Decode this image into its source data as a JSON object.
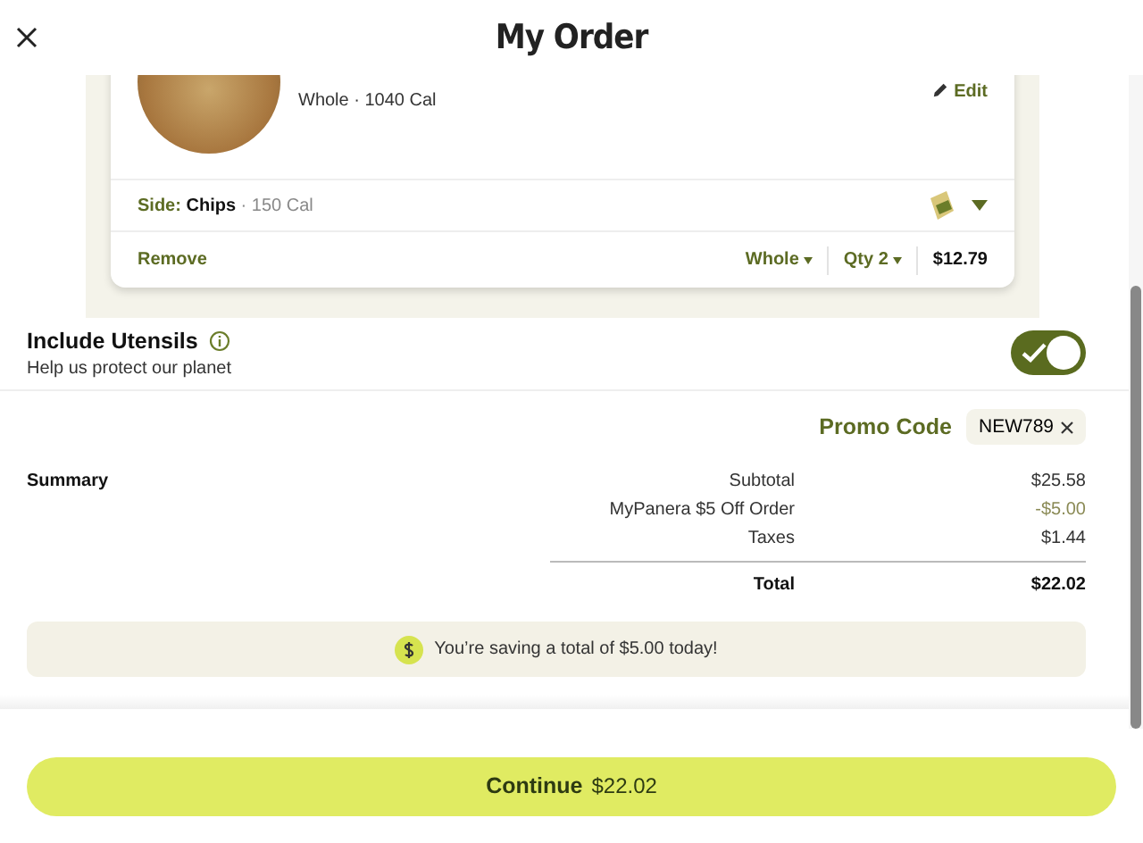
{
  "header": {
    "title": "My Order"
  },
  "item": {
    "details": "Whole · 1040 Cal",
    "edit": "Edit",
    "side_label": "Side:",
    "side_name": "Chips",
    "side_cal": "· 150 Cal",
    "remove": "Remove",
    "size": "Whole",
    "qty": "Qty 2",
    "price": "$12.79"
  },
  "utensils": {
    "title": "Include Utensils",
    "subtitle": "Help us protect our planet",
    "on": true
  },
  "promo": {
    "label": "Promo Code",
    "code": "NEW789"
  },
  "summary": {
    "title": "Summary",
    "lines": [
      {
        "label": "Subtotal",
        "value": "$25.58",
        "kind": "normal"
      },
      {
        "label": "MyPanera $5 Off Order",
        "value": "-$5.00",
        "kind": "discount"
      },
      {
        "label": "Taxes",
        "value": "$1.44",
        "kind": "normal"
      },
      {
        "label": "Total",
        "value": "$22.02",
        "kind": "total"
      }
    ]
  },
  "savings": "You’re saving a total of $5.00 today!",
  "continue": {
    "label": "Continue",
    "amount": "$22.02"
  }
}
